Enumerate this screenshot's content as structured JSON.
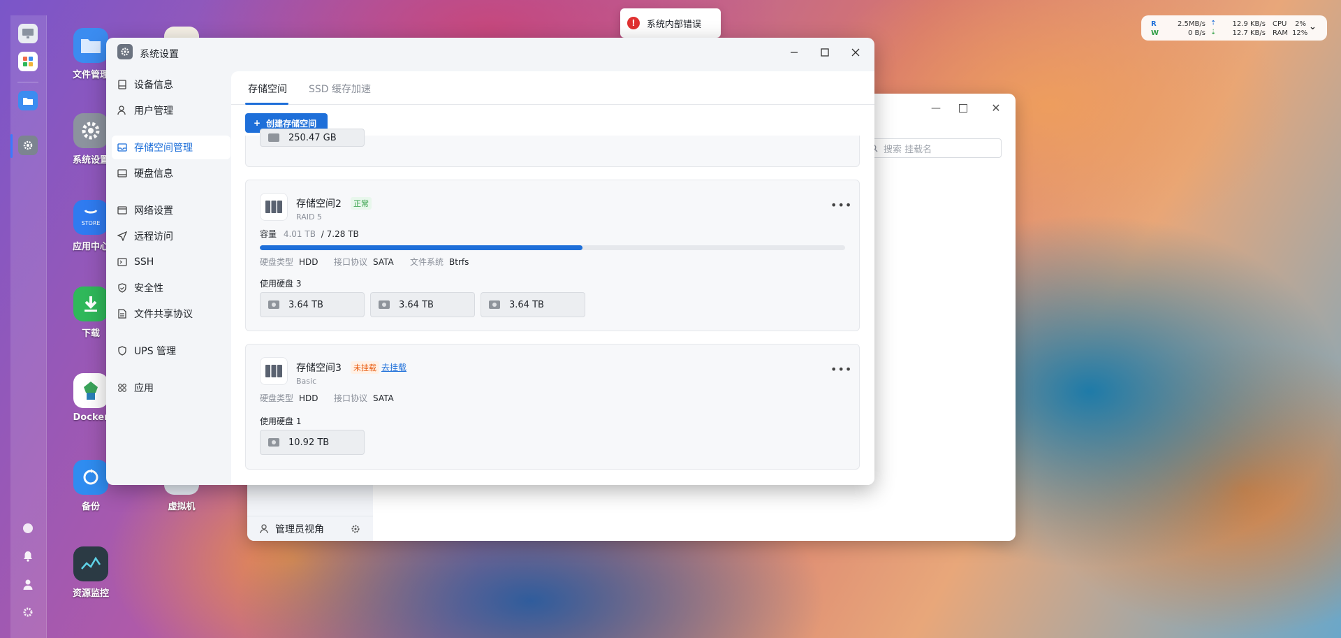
{
  "desktop": {
    "icons": [
      {
        "label": "文件管理",
        "color": "#3b8cf0"
      },
      {
        "label": "系统设置",
        "color": "#8c939e"
      },
      {
        "label": "应用中心",
        "color": "#2f7bf0"
      },
      {
        "label": "下载",
        "color": "#2fb85a"
      },
      {
        "label": "Docker",
        "color": "#ffffff"
      },
      {
        "label": "备份",
        "color": "#2f8cf0"
      },
      {
        "label": "资源监控",
        "color": "#2b3a44"
      },
      {
        "label": "虚拟机",
        "color": "#e8eef6"
      }
    ],
    "store_text": "STORE"
  },
  "toast": {
    "icon": "error-icon",
    "text": "系统内部错误"
  },
  "net_widget": {
    "r_label": "R",
    "w_label": "W",
    "r_speed": "2.5MB/s",
    "w_speed": "0 B/s",
    "up_speed": "12.9 KB/s",
    "down_speed": "12.7 KB/s",
    "cpu_label": "CPU",
    "ram_label": "RAM",
    "cpu_value": "2%",
    "ram_value": "12%"
  },
  "bg_window": {
    "search_placeholder": "搜索 挂载名",
    "footer_label": "管理员视角"
  },
  "window": {
    "title": "系统设置",
    "nav": [
      {
        "label": "设备信息",
        "icon": "device-icon"
      },
      {
        "label": "用户管理",
        "icon": "user-icon"
      },
      {
        "label": "存储空间管理",
        "icon": "storage-icon",
        "active": true
      },
      {
        "label": "硬盘信息",
        "icon": "disk-icon"
      },
      {
        "label": "网络设置",
        "icon": "network-icon"
      },
      {
        "label": "远程访问",
        "icon": "remote-icon"
      },
      {
        "label": "SSH",
        "icon": "ssh-icon"
      },
      {
        "label": "安全性",
        "icon": "shield-icon"
      },
      {
        "label": "文件共享协议",
        "icon": "file-share-icon"
      },
      {
        "label": "UPS 管理",
        "icon": "ups-icon"
      },
      {
        "label": "应用",
        "icon": "apps-icon"
      }
    ],
    "tabs": [
      {
        "label": "存储空间",
        "active": true
      },
      {
        "label": "SSD 缓存加速",
        "active": false
      }
    ],
    "create_button": "创建存储空间",
    "partial_card_disk": "250.47 GB",
    "cards": [
      {
        "name": "存储空间2",
        "status": "正常",
        "raid": "RAID 5",
        "capacity_label": "容量",
        "used": "4.01 TB",
        "total": "/ 7.28 TB",
        "used_fraction": 0.551,
        "disk_type_label": "硬盘类型",
        "disk_type": "HDD",
        "interface_label": "接口协议",
        "interface": "SATA",
        "fs_label": "文件系统",
        "fs": "Btrfs",
        "disks_label": "使用硬盘 3",
        "disks": [
          "3.64 TB",
          "3.64 TB",
          "3.64 TB"
        ]
      },
      {
        "name": "存储空间3",
        "status": "未挂载",
        "action": "去挂载",
        "raid": "Basic",
        "disk_type_label": "硬盘类型",
        "disk_type": "HDD",
        "interface_label": "接口协议",
        "interface": "SATA",
        "disks_label": "使用硬盘 1",
        "disks": [
          "10.92 TB"
        ]
      }
    ]
  }
}
